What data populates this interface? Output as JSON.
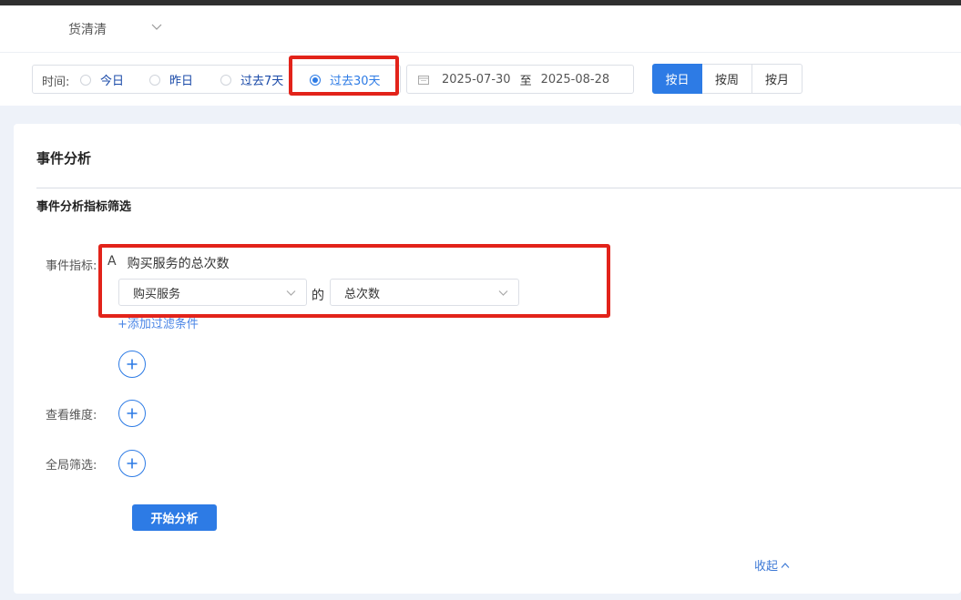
{
  "header": {
    "store_name": "货清清"
  },
  "filter": {
    "time_label": "时间:",
    "options": [
      "今日",
      "昨日",
      "过去7天",
      "过去30天"
    ],
    "selected": "过去30天",
    "date_start": "2025-07-30",
    "date_sep": "至",
    "date_end": "2025-08-28",
    "granularity": [
      "按日",
      "按周",
      "按月"
    ],
    "granularity_selected": "按日"
  },
  "panel": {
    "title": "事件分析",
    "subtitle": "事件分析指标筛选",
    "metric_label": "事件指标:",
    "metric_letter": "A",
    "metric_name": "购买服务的总次数",
    "event_select": "购买服务",
    "of_text": "的",
    "measure_select": "总次数",
    "add_filter": "+添加过滤条件",
    "dimension_label": "查看维度:",
    "global_filter_label": "全局筛选:",
    "start_button": "开始分析",
    "collapse": "收起"
  },
  "colors": {
    "accent": "#2d7be5",
    "highlight": "#e2231a"
  }
}
